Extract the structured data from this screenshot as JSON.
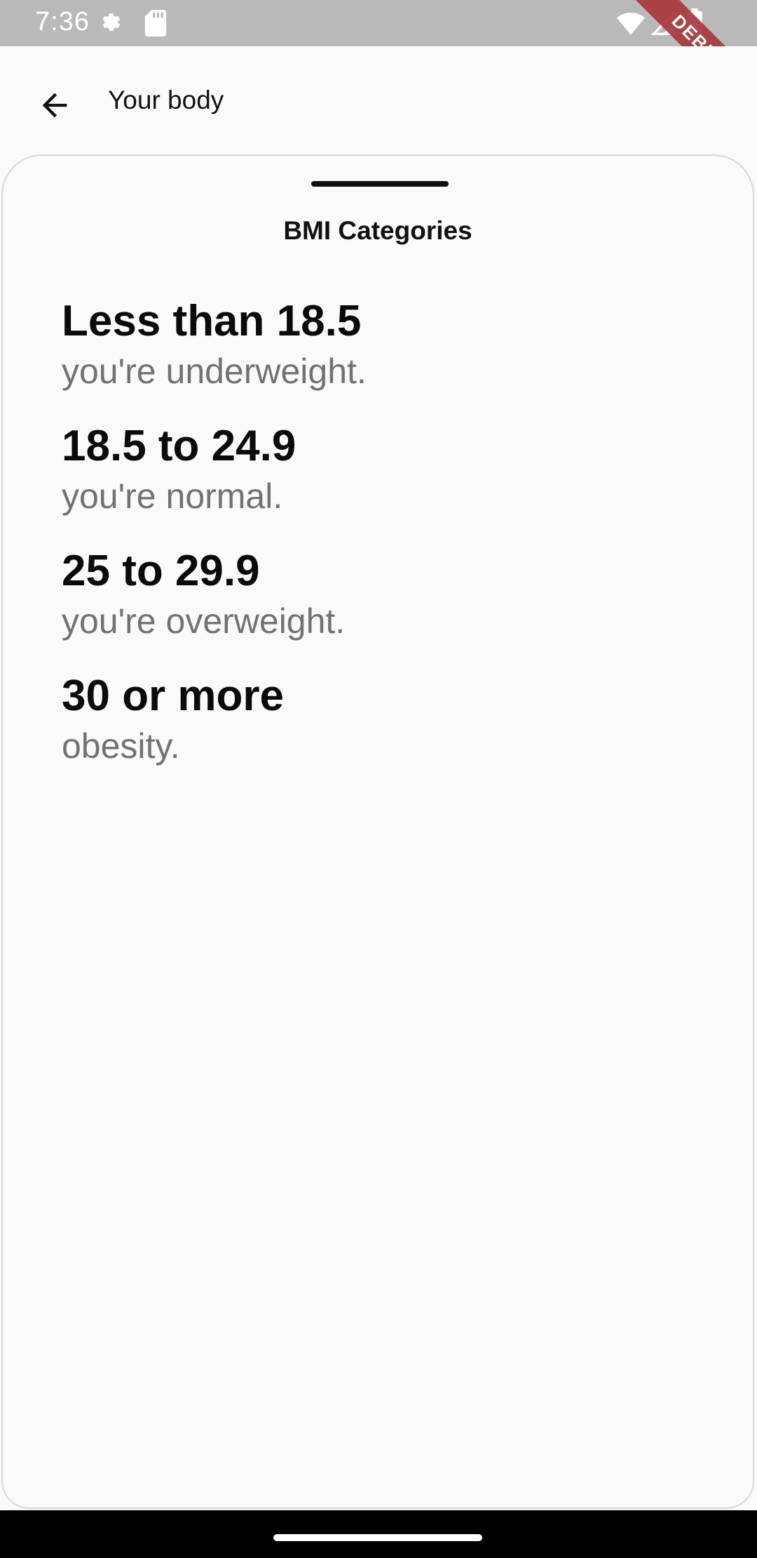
{
  "status_bar": {
    "time": "7:36",
    "icons": [
      "settings-gear-icon",
      "sd-card-icon",
      "wifi-icon",
      "signal-icon",
      "battery-icon"
    ]
  },
  "debug_banner": "DEBUG",
  "app_bar": {
    "back_icon": "arrow-left-icon",
    "title": "Your body"
  },
  "sheet": {
    "title": "BMI Categories",
    "categories": [
      {
        "range": "Less than 18.5",
        "description": "you're underweight."
      },
      {
        "range": "18.5 to 24.9",
        "description": "you're normal."
      },
      {
        "range": "25 to 29.9",
        "description": "you're overweight."
      },
      {
        "range": "30 or more",
        "description": "obesity."
      }
    ]
  },
  "colors": {
    "status_bar_bg": "#b9b9b9",
    "background": "#fafafa",
    "description_text": "#727272",
    "debug_ribbon": "#a7383c"
  }
}
